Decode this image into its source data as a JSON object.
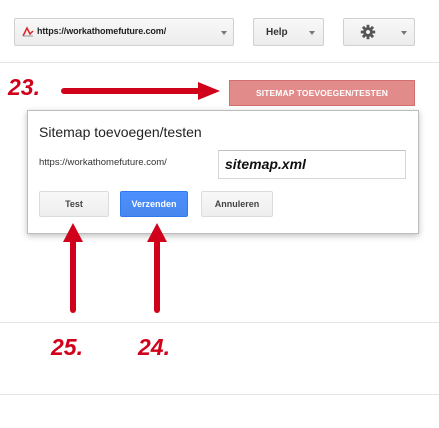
{
  "toolbar": {
    "site_url": "https://workathomefuture.com/",
    "help_label": "Help",
    "gear_icon": "gear-icon"
  },
  "sitemap_button": {
    "label": "SITEMAP TOEVOEGEN/TESTEN"
  },
  "dialog": {
    "title": "Sitemap toevoegen/testen",
    "url_prefix": "https://workathomefuture.com/",
    "input_value": "sitemap.xml",
    "test_label": "Test",
    "submit_label": "Verzenden",
    "cancel_label": "Annuleren"
  },
  "annotations": {
    "step_23": "23.",
    "step_24": "24.",
    "step_25": "25."
  },
  "colors": {
    "annotation_red": "#d0021b",
    "sitemap_button_bg": "#e28b8b",
    "submit_blue": "#4787ed"
  }
}
